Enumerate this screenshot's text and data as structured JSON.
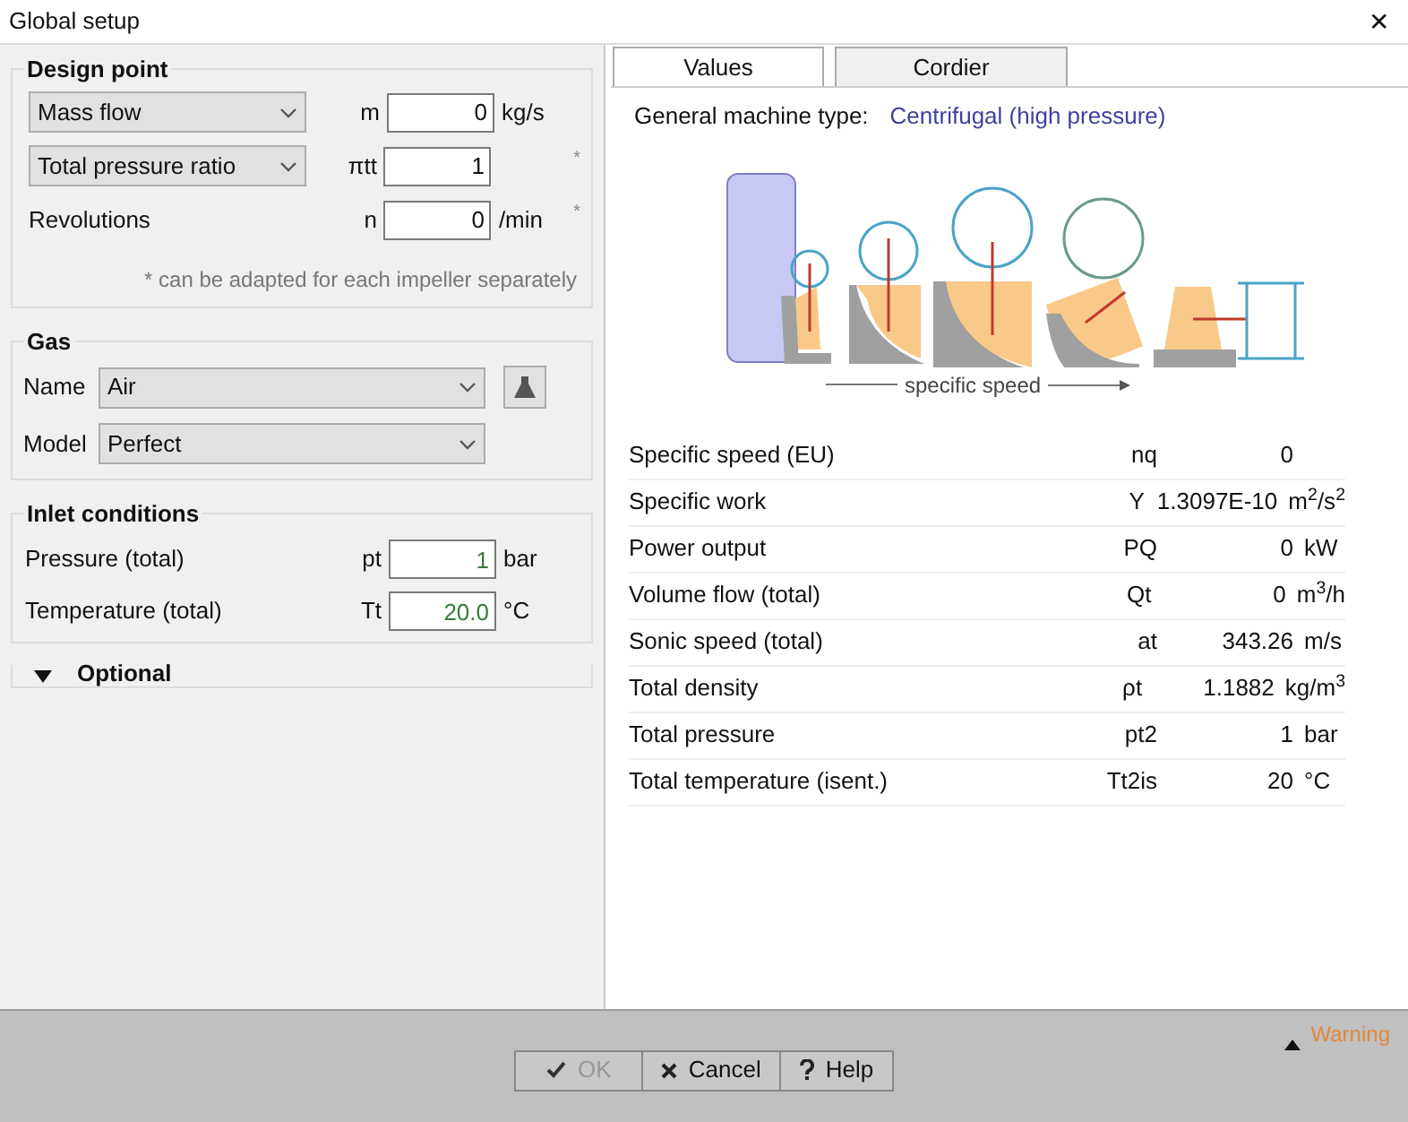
{
  "window": {
    "title": "Global setup",
    "close": "✕"
  },
  "design_point": {
    "title": "Design point",
    "rows": [
      {
        "kind": "select",
        "value": "Mass flow",
        "symbol": "m",
        "field": "0",
        "unit": "kg/s"
      },
      {
        "kind": "select",
        "value": "Total pressure ratio",
        "symbol": "πtt",
        "field": "1",
        "star": "*"
      },
      {
        "kind": "label",
        "value": "Revolutions",
        "symbol": "n",
        "field": "0",
        "unit": "/min",
        "star": "*"
      }
    ],
    "note": "* can be adapted for each impeller separately"
  },
  "gas": {
    "title": "Gas",
    "name_label": "Name",
    "name": "Air",
    "model_label": "Model",
    "model": "Perfect"
  },
  "inlet": {
    "title": "Inlet conditions",
    "rows": [
      {
        "label": "Pressure (total)",
        "symbol": "pt",
        "field": "1",
        "unit": "bar"
      },
      {
        "label": "Temperature (total)",
        "symbol": "Tt",
        "field": "20.0",
        "unit": "°C"
      }
    ]
  },
  "optional": {
    "label": "Optional",
    "expanded": false
  },
  "tabs": [
    {
      "label": "Values",
      "selected": true
    },
    {
      "label": "Cordier",
      "selected": false
    }
  ],
  "machine_type": {
    "label": "General machine type:",
    "value": "Centrifugal (high pressure)"
  },
  "diagram": {
    "axis_label": "specific speed"
  },
  "results": [
    {
      "label": "Specific speed (EU)",
      "symbol": "nq",
      "value": "0"
    },
    {
      "label": "Specific work",
      "symbol": "Y",
      "value": "1.3097E-10",
      "unit": "m$^{2}$/s$^{2}$"
    },
    {
      "label": "Power output",
      "symbol": "PQ",
      "value": "0",
      "unit": "kW"
    },
    {
      "label": "Volume flow (total)",
      "symbol": "Qt",
      "value": "0",
      "unit": "m$^{3}$/h"
    },
    {
      "label": "Sonic speed (total)",
      "symbol": "at",
      "value": "343.26",
      "unit": "m/s"
    },
    {
      "label": "Total density",
      "symbol": "ρt",
      "value": "1.1882",
      "unit": "kg/m$^{3}$"
    },
    {
      "label": "Total pressure",
      "symbol": "pt2",
      "value": "1",
      "unit": "bar"
    },
    {
      "label": "Total temperature (isent.)",
      "symbol": "Tt2is",
      "value": "20",
      "unit": "°C"
    }
  ],
  "buttons": [
    {
      "kind": "ok",
      "label": "OK",
      "disabled": true
    },
    {
      "kind": "cancel",
      "label": "Cancel",
      "disabled": false
    },
    {
      "kind": "help",
      "label": "Help",
      "disabled": false
    }
  ],
  "warning": {
    "label": "Warning"
  }
}
